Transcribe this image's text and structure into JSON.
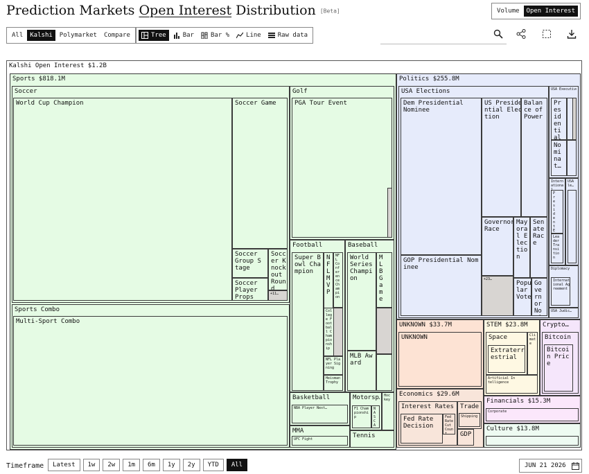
{
  "header": {
    "title_part1": "Prediction Markets",
    "title_part2": "Open Interest",
    "title_part3": "Distribution",
    "badge": "[Beta]"
  },
  "metric_toggle": {
    "options": [
      "Volume",
      "Open Interest"
    ],
    "selected": "Open Interest"
  },
  "source_toggle": {
    "options": [
      "All",
      "Kalshi",
      "Polymarket",
      "Compare"
    ],
    "selected": "Kalshi"
  },
  "view_toggle": {
    "options": [
      "Tree",
      "Bar",
      "Bar %",
      "Line",
      "Raw data"
    ],
    "selected": "Tree"
  },
  "icons": [
    "search-icon",
    "share-icon",
    "expand-icon",
    "download-icon"
  ],
  "timeframe": {
    "label": "Timeframe",
    "options": [
      "Latest",
      "1w",
      "2w",
      "1m",
      "6m",
      "1y",
      "2y",
      "YTD",
      "All"
    ],
    "selected": "All"
  },
  "date": "JUN 21 2026",
  "colors": {
    "sports": "#e5fbe4",
    "politics": "#e6ebfb",
    "unknown": "#fde3d4",
    "economics": "#f8e5da",
    "stem": "#fef8e3",
    "crypto": "#f5e6fb",
    "financials": "#fbe7fb",
    "culture": "#eefbf2",
    "other": "#d8d5d2"
  },
  "chart_data": {
    "type": "treemap",
    "root": {
      "name": "Kalshi",
      "label": "Kalshi Open Interest $1.2B"
    },
    "categories": [
      {
        "name": "Sports",
        "label": "Sports $818.1M",
        "value": 818.1,
        "unit": "$M",
        "color_key": "sports",
        "groups": [
          {
            "name": "Soccer",
            "markets": [
              "World Cup Champion",
              "Soccer Game",
              "Soccer Group Stage",
              "Soccer Knockout Round",
              "Soccer Player Props",
              "+11…"
            ]
          },
          {
            "name": "Golf",
            "markets": [
              "PGA Tour Event"
            ]
          },
          {
            "name": "Football",
            "markets": [
              "Super Bowl Champion",
              "NFL MVP",
              "NFL Conference Champion",
              "College Football Championship",
              "NFL Player Signing",
              "Heisman Trophy"
            ]
          },
          {
            "name": "Baseball",
            "markets": [
              "World Series Champion",
              "MLB Game",
              "MLB Award"
            ]
          },
          {
            "name": "Basketball",
            "markets": [
              "NBA Player Next…"
            ]
          },
          {
            "name": "Motorsp…",
            "markets": [
              "F1 Championship",
              "NASCAR"
            ]
          },
          {
            "name": "Hockey",
            "markets": []
          },
          {
            "name": "MMA",
            "markets": [
              "UFC Fight"
            ]
          },
          {
            "name": "Tennis",
            "markets": []
          },
          {
            "name": "Sports Combo",
            "markets": [
              "Multi-Sport Combo"
            ]
          }
        ]
      },
      {
        "name": "Politics",
        "label": "Politics $255.8M",
        "value": 255.8,
        "unit": "$M",
        "color_key": "politics",
        "groups": [
          {
            "name": "USA Elections",
            "markets": [
              "Dem Presidential Nominee",
              "US Presidential Election",
              "Balance of Power",
              "GOP Presidential Nominee",
              "Governor Race",
              "Mayoral Election",
              "Senate Race",
              "Popular Vote",
              "Governor Nominee",
              "+23…"
            ]
          },
          {
            "name": "USA Executive…",
            "markets": [
              "Presidential Tenure",
              "Nominat…"
            ]
          },
          {
            "name": "International…",
            "markets": [
              "President Election",
              "Leader Transition"
            ]
          },
          {
            "name": "USA le…",
            "markets": []
          },
          {
            "name": "Diplomacy",
            "markets": [
              "International Agreement"
            ]
          },
          {
            "name": "USA Judic…",
            "markets": []
          }
        ]
      },
      {
        "name": "UNKNOWN",
        "label": "UNKNOWN $33.7M",
        "value": 33.7,
        "unit": "$M",
        "color_key": "unknown",
        "groups": [
          {
            "name": "UNKNOWN",
            "markets": []
          }
        ]
      },
      {
        "name": "Economics",
        "label": "Economics $29.6M",
        "value": 29.6,
        "unit": "$M",
        "color_key": "economics",
        "groups": [
          {
            "name": "Interest Rates",
            "markets": [
              "Fed Rate Decision",
              "Fed Rate Cut Count"
            ]
          },
          {
            "name": "Trade",
            "markets": [
              "Shipping"
            ]
          },
          {
            "name": "GDP",
            "markets": []
          }
        ]
      },
      {
        "name": "STEM",
        "label": "STEM $23.8M",
        "value": 23.8,
        "unit": "$M",
        "color_key": "stem",
        "groups": [
          {
            "name": "Space",
            "markets": [
              "Extraterrestrial"
            ]
          },
          {
            "name": "Climate",
            "markets": []
          },
          {
            "name": "Artificial Intelligence",
            "markets": []
          }
        ]
      },
      {
        "name": "Crypto",
        "label": "Crypto…",
        "value": null,
        "unit": "$M",
        "color_key": "crypto",
        "groups": [
          {
            "name": "Bitcoin",
            "markets": [
              "Bitcoin Price"
            ]
          }
        ]
      },
      {
        "name": "Financials",
        "label": "Financials $15.3M",
        "value": 15.3,
        "unit": "$M",
        "color_key": "financials",
        "groups": [
          {
            "name": "Corporate",
            "markets": []
          }
        ]
      },
      {
        "name": "Culture",
        "label": "Culture $13.8M",
        "value": 13.8,
        "unit": "$M",
        "color_key": "culture",
        "groups": []
      }
    ]
  }
}
